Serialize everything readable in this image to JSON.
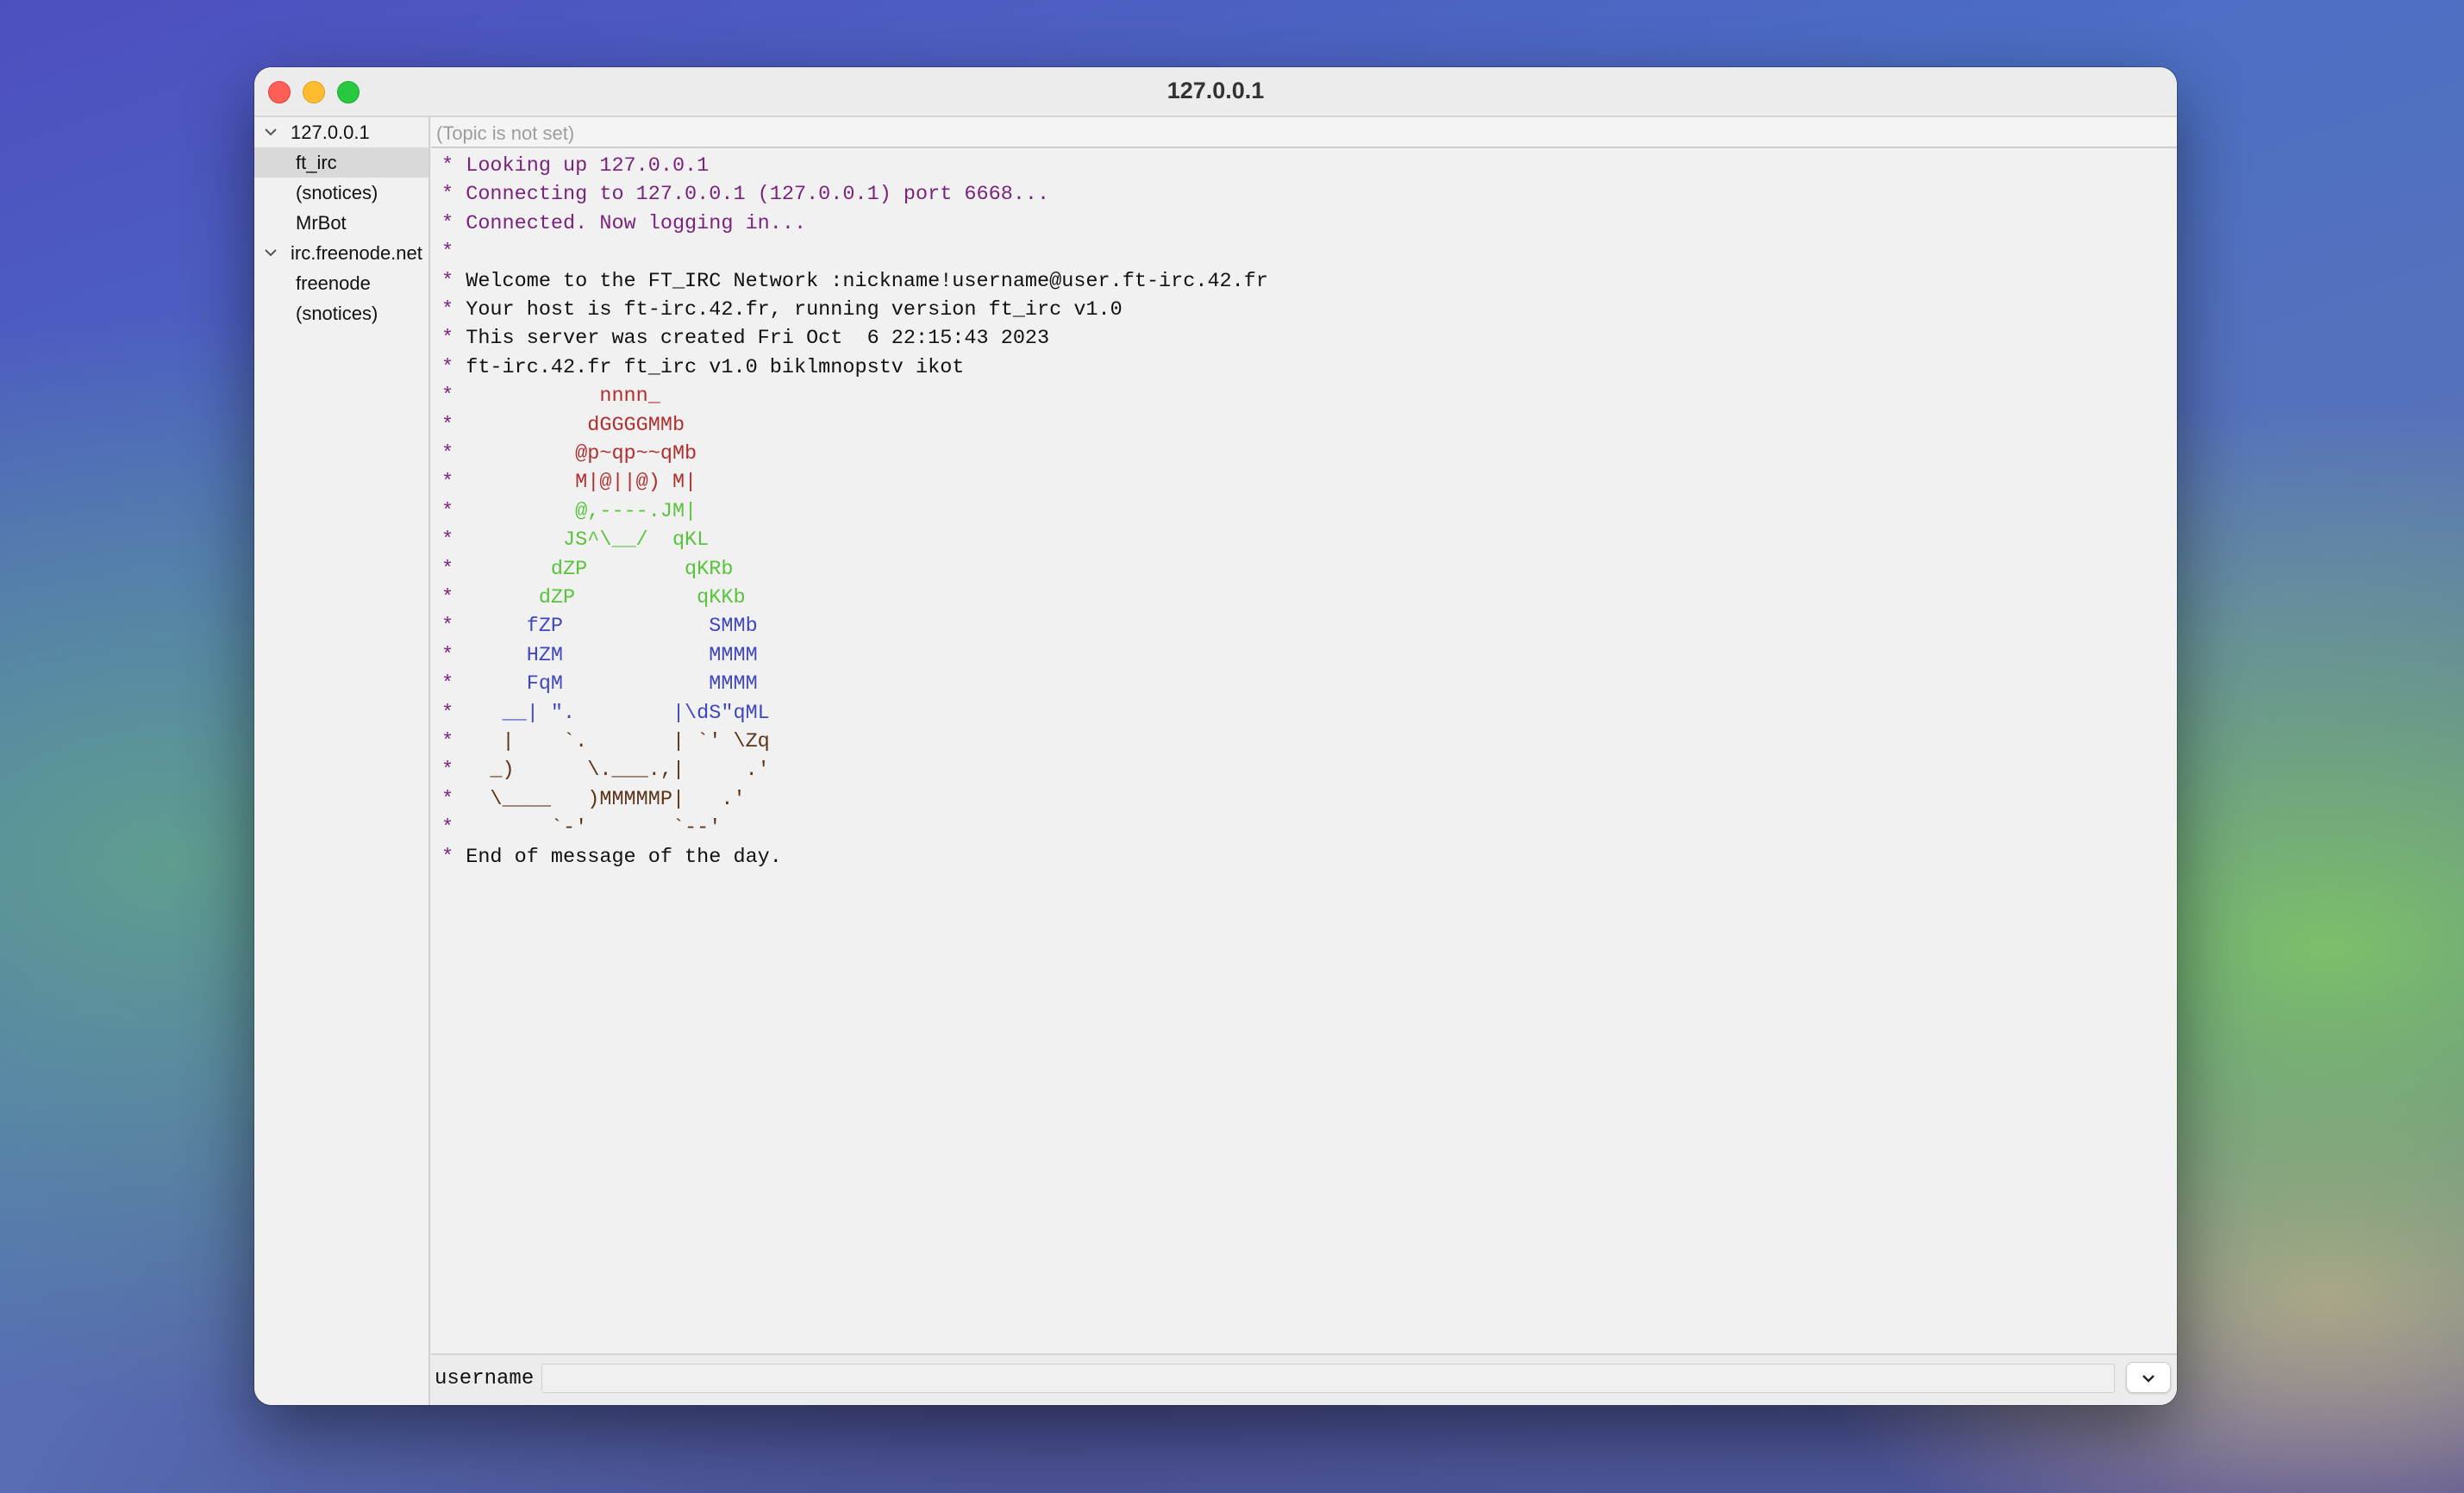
{
  "window": {
    "title": "127.0.0.1"
  },
  "sidebar": {
    "items": [
      {
        "type": "server",
        "label": "127.0.0.1",
        "expanded": true,
        "selected": false
      },
      {
        "type": "channel",
        "label": "ft_irc",
        "selected": true
      },
      {
        "type": "channel",
        "label": "(snotices)",
        "selected": false
      },
      {
        "type": "channel",
        "label": "MrBot",
        "selected": false
      },
      {
        "type": "server",
        "label": "irc.freenode.net",
        "expanded": true,
        "selected": false
      },
      {
        "type": "channel",
        "label": "freenode",
        "selected": false
      },
      {
        "type": "channel",
        "label": "(snotices)",
        "selected": false
      }
    ]
  },
  "topic": {
    "text": "(Topic is not set)"
  },
  "log": {
    "lines": [
      {
        "text": "Looking up 127.0.0.1",
        "color": "#7a237d"
      },
      {
        "text": "Connecting to 127.0.0.1 (127.0.0.1) port 6668...",
        "color": "#7a237d"
      },
      {
        "text": "Connected. Now logging in...",
        "color": "#7a237d"
      },
      {
        "text": "",
        "color": "#111111"
      },
      {
        "text": "Welcome to the FT_IRC Network :nickname!username@user.ft-irc.42.fr",
        "color": "#111111"
      },
      {
        "text": "Your host is ft-irc.42.fr, running version ft_irc v1.0",
        "color": "#111111"
      },
      {
        "text": "This server was created Fri Oct  6 22:15:43 2023",
        "color": "#111111"
      },
      {
        "text": "ft-irc.42.fr ft_irc v1.0 biklmnopstv ikot",
        "color": "#111111"
      },
      {
        "text": "           nnnn_",
        "color": "#b03030"
      },
      {
        "text": "          dGGGGMMb",
        "color": "#b03030"
      },
      {
        "text": "         @p~qp~~qMb",
        "color": "#b03030"
      },
      {
        "text": "         M|@||@) M|",
        "color": "#b03030"
      },
      {
        "text": "         @,----.JM|",
        "color": "#5ac33e"
      },
      {
        "text": "        JS^\\__/  qKL",
        "color": "#5ac33e"
      },
      {
        "text": "       dZP        qKRb",
        "color": "#5ac33e"
      },
      {
        "text": "      dZP          qKKb",
        "color": "#5ac33e"
      },
      {
        "text": "     fZP            SMMb",
        "color": "#4046bf"
      },
      {
        "text": "     HZM            MMMM",
        "color": "#4046bf"
      },
      {
        "text": "     FqM            MMMM",
        "color": "#4046bf"
      },
      {
        "text": "   __| \".        |\\dS\"qML",
        "color": "#4046bf"
      },
      {
        "text": "   |    `.       | `' \\Zq",
        "color": "#5b3319"
      },
      {
        "text": "  _)      \\.___.,|     .'",
        "color": "#5b3319"
      },
      {
        "text": "  \\____   )MMMMMP|   .'",
        "color": "#5b3319"
      },
      {
        "text": "       `-'       `--'",
        "color": "#5b3319"
      },
      {
        "text": "End of message of the day.",
        "color": "#111111"
      }
    ]
  },
  "input": {
    "nickname": "username",
    "value": ""
  }
}
